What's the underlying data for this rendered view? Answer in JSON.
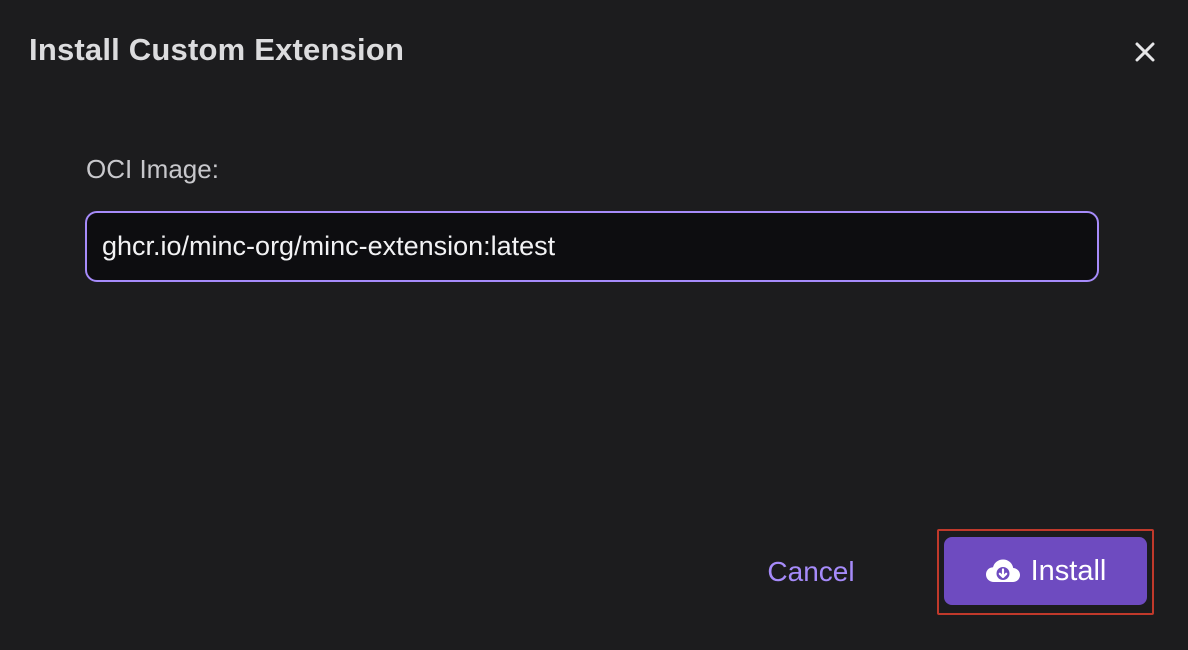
{
  "dialog": {
    "title": "Install Custom Extension",
    "close_icon": "close-icon"
  },
  "form": {
    "label": "OCI Image:",
    "input_value": "ghcr.io/minc-org/minc-extension:latest",
    "input_placeholder": ""
  },
  "actions": {
    "cancel_label": "Cancel",
    "install_label": "Install",
    "install_icon": "cloud-download-icon"
  },
  "colors": {
    "background": "#1c1c1e",
    "accent": "#a68bfa",
    "primary_button": "#6e4bc0",
    "highlight": "#c0392b"
  }
}
